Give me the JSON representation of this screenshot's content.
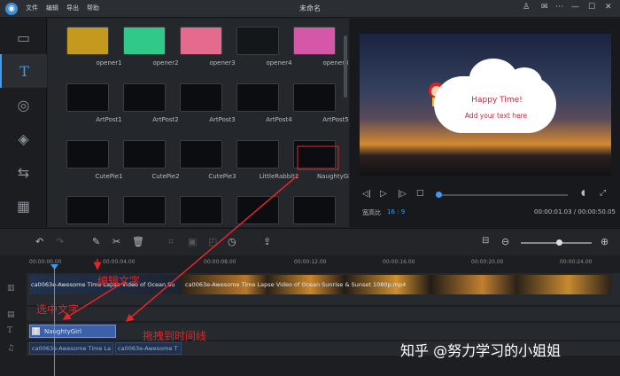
{
  "app": {
    "title": "未命名",
    "menu": [
      "文件",
      "编辑",
      "导出",
      "帮助"
    ]
  },
  "sidebar": {
    "items": [
      "media",
      "text",
      "filter",
      "overlay",
      "transition",
      "element"
    ]
  },
  "library": {
    "items": [
      {
        "label": "opener1",
        "color": "#c49a1e"
      },
      {
        "label": "opener2",
        "color": "#30c98a"
      },
      {
        "label": "opener3",
        "color": "#e46b8e"
      },
      {
        "label": "opener4",
        "color": "#14171a"
      },
      {
        "label": "opener3",
        "color": "#d457a8"
      },
      {
        "label": "ArtPost1",
        "color": "#0b0d10"
      },
      {
        "label": "ArtPost2",
        "color": "#0b0d10"
      },
      {
        "label": "ArtPost3",
        "color": "#0b0d10"
      },
      {
        "label": "ArtPost4",
        "color": "#0b0d10"
      },
      {
        "label": "ArtPost5",
        "color": "#0b0d10"
      },
      {
        "label": "CutePie1",
        "color": "#0b0d10"
      },
      {
        "label": "CutePie2",
        "color": "#0b0d10"
      },
      {
        "label": "CutePie3",
        "color": "#0b0d10"
      },
      {
        "label": "LittleRabbit1",
        "color": "#0b0d10"
      },
      {
        "label": "NaughtyGirl",
        "color": "#0b0d10"
      },
      {
        "label": "",
        "color": "#0b0d10"
      },
      {
        "label": "",
        "color": "#0b0d10"
      },
      {
        "label": "",
        "color": "#0b0d10"
      },
      {
        "label": "",
        "color": "#0b0d10"
      },
      {
        "label": "",
        "color": "#0b0d10"
      }
    ]
  },
  "preview": {
    "cloud_title": "Happy Time!",
    "cloud_sub": "Add your text here",
    "aspect_label": "宽高比",
    "aspect_value": "16 : 9",
    "time": "00:00:01.03 / 00:00:50.05"
  },
  "ruler": [
    "00:00:00.00",
    "00:00:04.00",
    "00:00:08.00",
    "00:00:12.00",
    "00:00:16.00",
    "00:00:20.00",
    "00:00:24.00"
  ],
  "tracks": {
    "video_clip1": "ca0063e-Awesome Time Lapse Video of Ocean Su",
    "video_clip2": "ca0063e-Awesome Time Lapse Video of Ocean Sunrise & Sunset 1080p.mp4",
    "text_clip": "NaughtyGirl",
    "audio_clip1": "ca0063e-Awesome Time La",
    "audio_clip2": "ca0063e-Awesome T"
  },
  "annotations": {
    "edit": "编辑文字",
    "select": "选中文字",
    "drag": "拖拽到时间线"
  },
  "watermark": "知乎 @努力学习的小姐姐",
  "colors": {
    "accent": "#3d9bf0",
    "annotation": "#e2262a",
    "text_clip": "#3d61a8"
  }
}
